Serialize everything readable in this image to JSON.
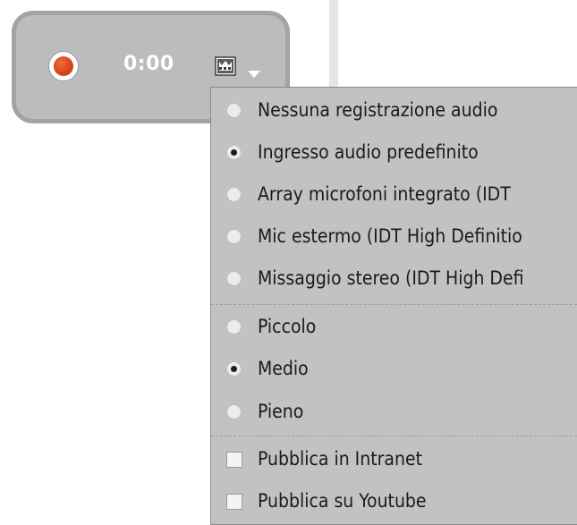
{
  "recorder": {
    "timer": "0:00",
    "record_icon": "record-dot-icon",
    "device_icon": "audio-device-icon",
    "dropdown_icon": "chevron-down-icon",
    "record_color": "#d94519"
  },
  "menu": {
    "audio_inputs": [
      {
        "label": "Nessuna registrazione audio",
        "checked": false
      },
      {
        "label": "Ingresso audio predefinito",
        "checked": true
      },
      {
        "label": "Array microfoni integrato (IDT",
        "checked": false
      },
      {
        "label": "Mic estermo (IDT High Definitio",
        "checked": false
      },
      {
        "label": "Missaggio stereo (IDT High Defi",
        "checked": false
      }
    ],
    "sizes": [
      {
        "label": "Piccolo",
        "checked": false
      },
      {
        "label": "Medio",
        "checked": true
      },
      {
        "label": "Pieno",
        "checked": false
      }
    ],
    "publish": [
      {
        "label": "Pubblica in Intranet",
        "checked": false
      },
      {
        "label": "Pubblica su Youtube",
        "checked": false
      }
    ]
  }
}
